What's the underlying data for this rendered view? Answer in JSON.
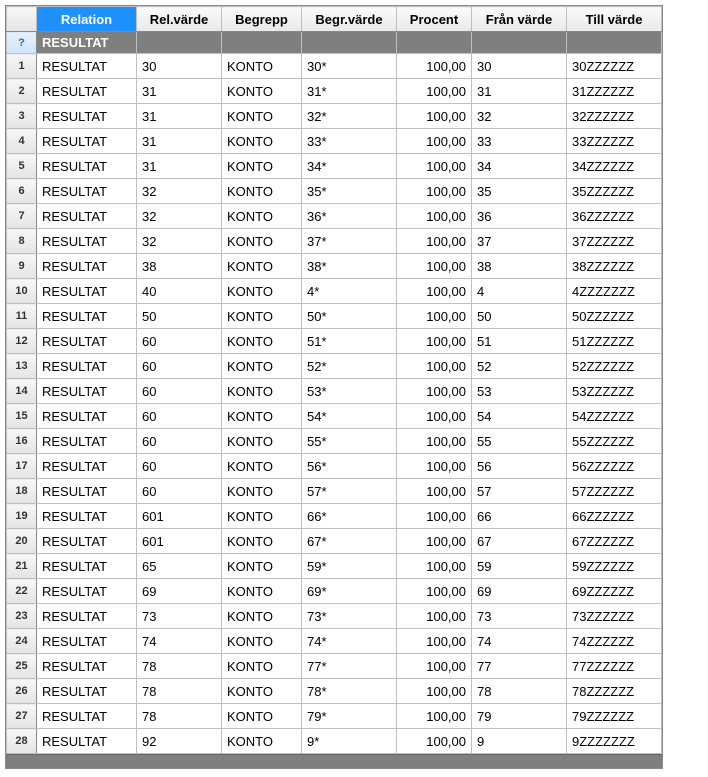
{
  "columns": {
    "relation": "Relation",
    "relvarde": "Rel.värde",
    "begrepp": "Begrepp",
    "begrvarde": "Begr.värde",
    "procent": "Procent",
    "franvarde": "Från värde",
    "tillvarde": "Till värde"
  },
  "filterRow": {
    "rownum": "?",
    "relation": "RESULTAT"
  },
  "rows": [
    {
      "n": "1",
      "relation": "RESULTAT",
      "rv": "30",
      "beg": "KONTO",
      "bv": "30*",
      "pct": "100,00",
      "fv": "30",
      "tv": "30ZZZZZZ"
    },
    {
      "n": "2",
      "relation": "RESULTAT",
      "rv": "31",
      "beg": "KONTO",
      "bv": "31*",
      "pct": "100,00",
      "fv": "31",
      "tv": "31ZZZZZZ"
    },
    {
      "n": "3",
      "relation": "RESULTAT",
      "rv": "31",
      "beg": "KONTO",
      "bv": "32*",
      "pct": "100,00",
      "fv": "32",
      "tv": "32ZZZZZZ"
    },
    {
      "n": "4",
      "relation": "RESULTAT",
      "rv": "31",
      "beg": "KONTO",
      "bv": "33*",
      "pct": "100,00",
      "fv": "33",
      "tv": "33ZZZZZZ"
    },
    {
      "n": "5",
      "relation": "RESULTAT",
      "rv": "31",
      "beg": "KONTO",
      "bv": "34*",
      "pct": "100,00",
      "fv": "34",
      "tv": "34ZZZZZZ"
    },
    {
      "n": "6",
      "relation": "RESULTAT",
      "rv": "32",
      "beg": "KONTO",
      "bv": "35*",
      "pct": "100,00",
      "fv": "35",
      "tv": "35ZZZZZZ"
    },
    {
      "n": "7",
      "relation": "RESULTAT",
      "rv": "32",
      "beg": "KONTO",
      "bv": "36*",
      "pct": "100,00",
      "fv": "36",
      "tv": "36ZZZZZZ"
    },
    {
      "n": "8",
      "relation": "RESULTAT",
      "rv": "32",
      "beg": "KONTO",
      "bv": "37*",
      "pct": "100,00",
      "fv": "37",
      "tv": "37ZZZZZZ"
    },
    {
      "n": "9",
      "relation": "RESULTAT",
      "rv": "38",
      "beg": "KONTO",
      "bv": "38*",
      "pct": "100,00",
      "fv": "38",
      "tv": "38ZZZZZZ"
    },
    {
      "n": "10",
      "relation": "RESULTAT",
      "rv": "40",
      "beg": "KONTO",
      "bv": "4*",
      "pct": "100,00",
      "fv": "4",
      "tv": "4ZZZZZZZ"
    },
    {
      "n": "11",
      "relation": "RESULTAT",
      "rv": "50",
      "beg": "KONTO",
      "bv": "50*",
      "pct": "100,00",
      "fv": "50",
      "tv": "50ZZZZZZ"
    },
    {
      "n": "12",
      "relation": "RESULTAT",
      "rv": "60",
      "beg": "KONTO",
      "bv": "51*",
      "pct": "100,00",
      "fv": "51",
      "tv": "51ZZZZZZ"
    },
    {
      "n": "13",
      "relation": "RESULTAT",
      "rv": "60",
      "beg": "KONTO",
      "bv": "52*",
      "pct": "100,00",
      "fv": "52",
      "tv": "52ZZZZZZ"
    },
    {
      "n": "14",
      "relation": "RESULTAT",
      "rv": "60",
      "beg": "KONTO",
      "bv": "53*",
      "pct": "100,00",
      "fv": "53",
      "tv": "53ZZZZZZ"
    },
    {
      "n": "15",
      "relation": "RESULTAT",
      "rv": "60",
      "beg": "KONTO",
      "bv": "54*",
      "pct": "100,00",
      "fv": "54",
      "tv": "54ZZZZZZ"
    },
    {
      "n": "16",
      "relation": "RESULTAT",
      "rv": "60",
      "beg": "KONTO",
      "bv": "55*",
      "pct": "100,00",
      "fv": "55",
      "tv": "55ZZZZZZ"
    },
    {
      "n": "17",
      "relation": "RESULTAT",
      "rv": "60",
      "beg": "KONTO",
      "bv": "56*",
      "pct": "100,00",
      "fv": "56",
      "tv": "56ZZZZZZ"
    },
    {
      "n": "18",
      "relation": "RESULTAT",
      "rv": "60",
      "beg": "KONTO",
      "bv": "57*",
      "pct": "100,00",
      "fv": "57",
      "tv": "57ZZZZZZ"
    },
    {
      "n": "19",
      "relation": "RESULTAT",
      "rv": "601",
      "beg": "KONTO",
      "bv": "66*",
      "pct": "100,00",
      "fv": "66",
      "tv": "66ZZZZZZ"
    },
    {
      "n": "20",
      "relation": "RESULTAT",
      "rv": "601",
      "beg": "KONTO",
      "bv": "67*",
      "pct": "100,00",
      "fv": "67",
      "tv": "67ZZZZZZ"
    },
    {
      "n": "21",
      "relation": "RESULTAT",
      "rv": "65",
      "beg": "KONTO",
      "bv": "59*",
      "pct": "100,00",
      "fv": "59",
      "tv": "59ZZZZZZ"
    },
    {
      "n": "22",
      "relation": "RESULTAT",
      "rv": "69",
      "beg": "KONTO",
      "bv": "69*",
      "pct": "100,00",
      "fv": "69",
      "tv": "69ZZZZZZ"
    },
    {
      "n": "23",
      "relation": "RESULTAT",
      "rv": "73",
      "beg": "KONTO",
      "bv": "73*",
      "pct": "100,00",
      "fv": "73",
      "tv": "73ZZZZZZ"
    },
    {
      "n": "24",
      "relation": "RESULTAT",
      "rv": "74",
      "beg": "KONTO",
      "bv": "74*",
      "pct": "100,00",
      "fv": "74",
      "tv": "74ZZZZZZ"
    },
    {
      "n": "25",
      "relation": "RESULTAT",
      "rv": "78",
      "beg": "KONTO",
      "bv": "77*",
      "pct": "100,00",
      "fv": "77",
      "tv": "77ZZZZZZ"
    },
    {
      "n": "26",
      "relation": "RESULTAT",
      "rv": "78",
      "beg": "KONTO",
      "bv": "78*",
      "pct": "100,00",
      "fv": "78",
      "tv": "78ZZZZZZ"
    },
    {
      "n": "27",
      "relation": "RESULTAT",
      "rv": "78",
      "beg": "KONTO",
      "bv": "79*",
      "pct": "100,00",
      "fv": "79",
      "tv": "79ZZZZZZ"
    },
    {
      "n": "28",
      "relation": "RESULTAT",
      "rv": "92",
      "beg": "KONTO",
      "bv": "9*",
      "pct": "100,00",
      "fv": "9",
      "tv": "9ZZZZZZZ"
    }
  ]
}
